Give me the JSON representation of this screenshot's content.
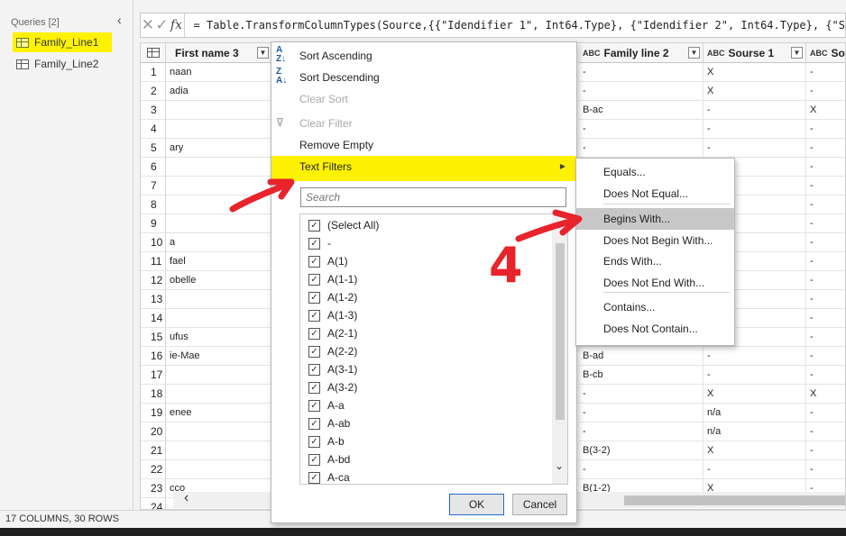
{
  "queries_pane": {
    "header": "Queries [2]",
    "collapse_glyph": "‹",
    "items": [
      {
        "label": "Family_Line1",
        "icon": "table-icon",
        "highlighted": true
      },
      {
        "label": "Family_Line2",
        "icon": "table-icon",
        "highlighted": false
      }
    ]
  },
  "formula_bar": {
    "cancel_glyph": "✕",
    "commit_glyph": "✓",
    "fx_label": "fx",
    "formula": "= Table.TransformColumnTypes(Source,{{\"Idendifier 1\", Int64.Type}, {\"Idendifier 2\", Int64.Type}, {\"S"
  },
  "grid": {
    "headers": {
      "col1": "First name 3",
      "col2": "Family line 2",
      "col3": "Sourse 1",
      "col4": "Sou"
    },
    "type_badge": "ABC",
    "rows": [
      {
        "n": "1",
        "name": "naan",
        "fam": "-",
        "src": "X",
        "s4": "-"
      },
      {
        "n": "2",
        "name": "adia",
        "fam": "-",
        "src": "X",
        "s4": "-"
      },
      {
        "n": "3",
        "name": "",
        "fam": "B-ac",
        "src": "-",
        "s4": "X"
      },
      {
        "n": "4",
        "name": "",
        "fam": "-",
        "src": "-",
        "s4": "-"
      },
      {
        "n": "5",
        "name": "ary",
        "fam": "-",
        "src": "-",
        "s4": "-"
      },
      {
        "n": "6",
        "name": "",
        "fam": "",
        "src": "",
        "s4": "-"
      },
      {
        "n": "7",
        "name": "",
        "fam": "",
        "src": "",
        "s4": "-"
      },
      {
        "n": "8",
        "name": "",
        "fam": "",
        "src": "",
        "s4": "-"
      },
      {
        "n": "9",
        "name": "",
        "fam": "",
        "src": "",
        "s4": "-"
      },
      {
        "n": "10",
        "name": "a",
        "fam": "",
        "src": "",
        "s4": "-"
      },
      {
        "n": "11",
        "name": "fael",
        "fam": "",
        "src": "",
        "s4": "-"
      },
      {
        "n": "12",
        "name": "obelle",
        "fam": "",
        "src": "",
        "s4": "-"
      },
      {
        "n": "13",
        "name": "",
        "fam": "",
        "src": "",
        "s4": "-"
      },
      {
        "n": "14",
        "name": "",
        "fam": "",
        "src": "",
        "s4": "-"
      },
      {
        "n": "15",
        "name": "ufus",
        "fam": "",
        "src": "",
        "s4": "-"
      },
      {
        "n": "16",
        "name": "ie-Mae",
        "fam": "B-ad",
        "src": "-",
        "s4": "-"
      },
      {
        "n": "17",
        "name": "",
        "fam": "B-cb",
        "src": "-",
        "s4": "-"
      },
      {
        "n": "18",
        "name": "",
        "fam": "-",
        "src": "X",
        "s4": "X"
      },
      {
        "n": "19",
        "name": "enee",
        "fam": "-",
        "src": "n/a",
        "s4": "-"
      },
      {
        "n": "20",
        "name": "",
        "fam": "-",
        "src": "n/a",
        "s4": "-"
      },
      {
        "n": "21",
        "name": "",
        "fam": "B(3-2)",
        "src": "X",
        "s4": "-"
      },
      {
        "n": "22",
        "name": "",
        "fam": "-",
        "src": "-",
        "s4": "-"
      },
      {
        "n": "23",
        "name": "cco",
        "fam": "B(1-2)",
        "src": "X",
        "s4": "-"
      },
      {
        "n": "24",
        "name": "",
        "fam": "",
        "src": "",
        "s4": ""
      }
    ]
  },
  "status_bar": {
    "text": "17 COLUMNS, 30 ROWS"
  },
  "filter_menu": {
    "sort_ascending": "Sort Ascending",
    "sort_descending": "Sort Descending",
    "clear_sort": "Clear Sort",
    "clear_filter": "Clear Filter",
    "remove_empty": "Remove Empty",
    "text_filters": "Text Filters",
    "search_placeholder": "Search",
    "values": [
      "(Select All)",
      "-",
      "A(1)",
      "A(1-1)",
      "A(1-2)",
      "A(1-3)",
      "A(2-1)",
      "A(2-2)",
      "A(3-1)",
      "A(3-2)",
      "A-a",
      "A-ab",
      "A-b",
      "A-bd",
      "A-ca"
    ],
    "ok": "OK",
    "cancel": "Cancel"
  },
  "text_filters_submenu": {
    "items": [
      "Equals...",
      "Does Not Equal...",
      "Begins With...",
      "Does Not Begin With...",
      "Ends With...",
      "Does Not End With...",
      "Contains...",
      "Does Not Contain..."
    ],
    "active_index": 2
  },
  "annotations": {
    "step_number": "4",
    "color": "#e8232b"
  },
  "colors": {
    "highlight": "#fff200",
    "submenu_active": "#c7c7c7"
  }
}
